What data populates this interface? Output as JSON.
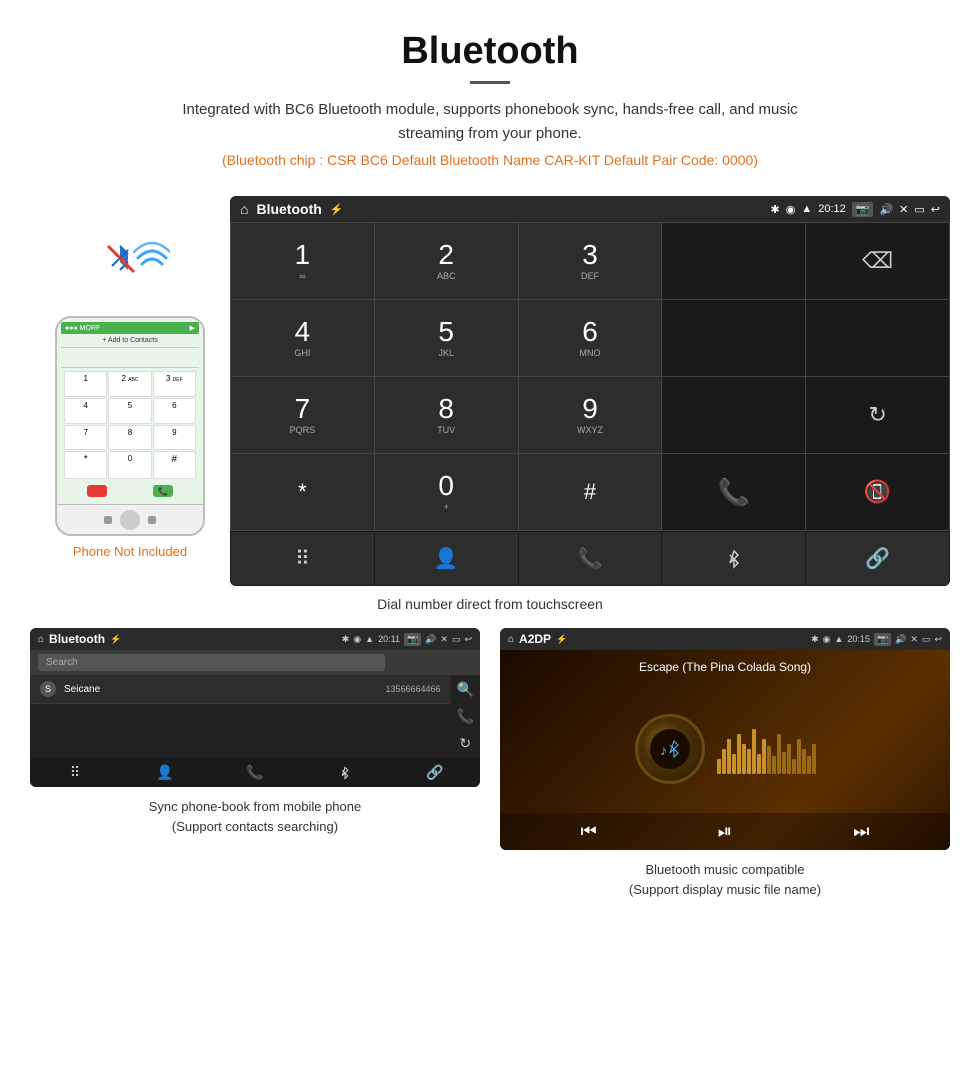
{
  "header": {
    "title": "Bluetooth",
    "subtitle": "Integrated with BC6 Bluetooth module, supports phonebook sync, hands-free call, and music streaming from your phone.",
    "orange_info": "(Bluetooth chip : CSR BC6    Default Bluetooth Name CAR-KIT    Default Pair Code: 0000)"
  },
  "phone": {
    "not_included": "Phone Not Included",
    "keypad_keys": [
      "1",
      "2",
      "3",
      "4",
      "5",
      "6",
      "7",
      "8",
      "9",
      "*",
      "0",
      "#"
    ]
  },
  "dialpad_screen": {
    "topbar_title": "Bluetooth",
    "topbar_usb": "⚡",
    "topbar_time": "20:12",
    "keys": [
      {
        "number": "1",
        "letters": "∞"
      },
      {
        "number": "2",
        "letters": "ABC"
      },
      {
        "number": "3",
        "letters": "DEF"
      },
      {
        "number": "4",
        "letters": "GHI"
      },
      {
        "number": "5",
        "letters": "JKL"
      },
      {
        "number": "6",
        "letters": "MNO"
      },
      {
        "number": "7",
        "letters": "PQRS"
      },
      {
        "number": "8",
        "letters": "TUV"
      },
      {
        "number": "9",
        "letters": "WXYZ"
      },
      {
        "number": "*",
        "letters": ""
      },
      {
        "number": "0",
        "letters": "+"
      },
      {
        "number": "#",
        "letters": ""
      }
    ],
    "caption": "Dial number direct from touchscreen"
  },
  "phonebook_screen": {
    "topbar_title": "Bluetooth",
    "topbar_time": "20:11",
    "search_placeholder": "Search",
    "contact_letter": "S",
    "contact_name": "Seicane",
    "contact_number": "13566664466",
    "caption_line1": "Sync phone-book from mobile phone",
    "caption_line2": "(Support contacts searching)"
  },
  "music_screen": {
    "topbar_title": "A2DP",
    "topbar_time": "20:15",
    "song_title": "Escape (The Pina Colada Song)",
    "caption_line1": "Bluetooth music compatible",
    "caption_line2": "(Support display music file name)"
  }
}
